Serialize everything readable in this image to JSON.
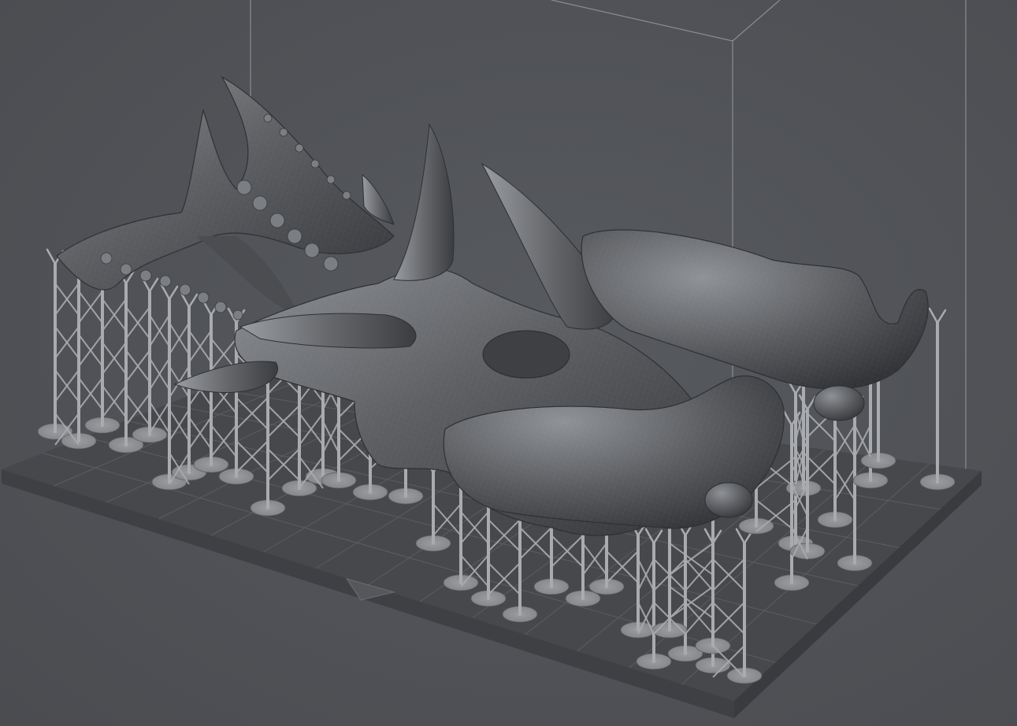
{
  "viewport": {
    "title": "",
    "background_color": "#505257",
    "volume_edge_color": "#8a8c90",
    "plate_color": "#45474b",
    "grid_color": "#5a5c61",
    "support_color": "#a9abae",
    "model_color": "#5e6064",
    "model_highlight_color": "#8d9094",
    "model_shadow_color": "#3a3b3e"
  },
  "scene": {
    "model_name": "",
    "model_icon": "dragon-skull-model",
    "support_icon": "lattice-support",
    "plate_icon": "build-plate",
    "volume_icon": "build-volume-box"
  }
}
